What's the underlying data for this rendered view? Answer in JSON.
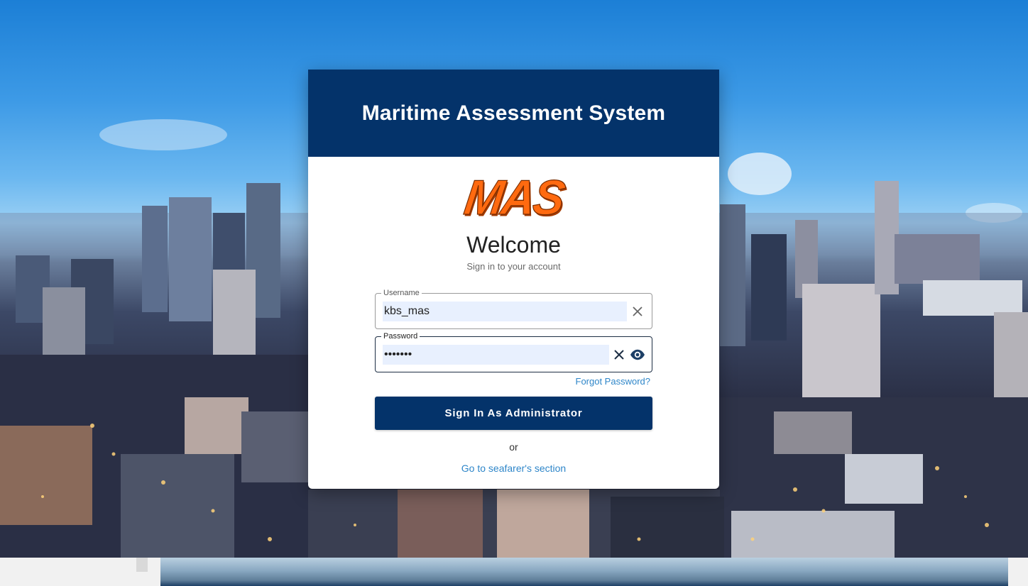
{
  "app": {
    "title": "Maritime Assessment System",
    "logo_text": "MAS"
  },
  "login": {
    "welcome": "Welcome",
    "subtitle": "Sign in to your account",
    "username": {
      "label": "Username",
      "value": "kbs_mas",
      "clear_icon": "close-icon"
    },
    "password": {
      "label": "Password",
      "value": "passwor",
      "clear_icon": "close-icon",
      "visibility_icon": "eye-icon"
    },
    "forgot_password": "Forgot Password?",
    "sign_in_button": "Sign In As Administrator",
    "or": "or",
    "seafarer_link": "Go to seafarer's section"
  },
  "colors": {
    "header": "#04336a",
    "button": "#04336a",
    "link": "#2e86c9",
    "logo": "#ff6a10",
    "autofill": "#e8f0fe"
  }
}
